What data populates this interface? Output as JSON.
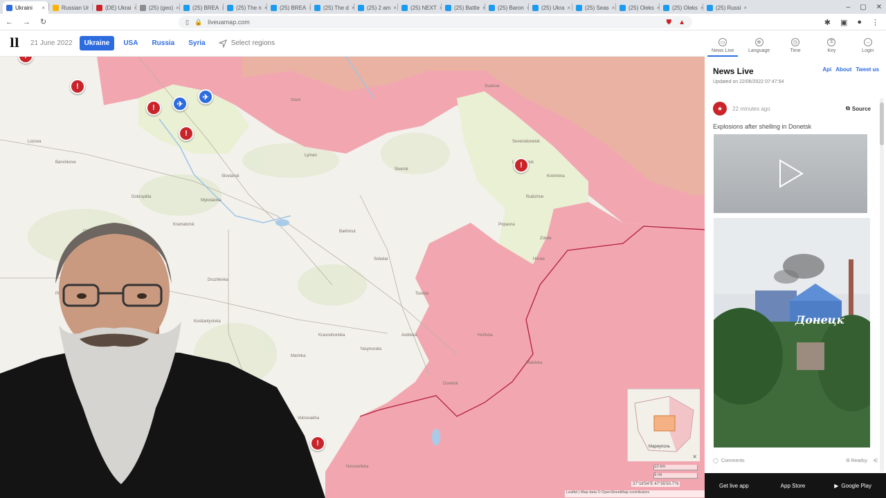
{
  "browser": {
    "tabs": [
      {
        "label": "Ukraini",
        "color": "#2d6cdf"
      },
      {
        "label": "Russian Ur",
        "color": "#ffb300"
      },
      {
        "label": "(DE) Ukrai",
        "color": "#c8242a"
      },
      {
        "label": "(25) (geo)",
        "color": "#8d8d8d"
      },
      {
        "label": "(25) BREA",
        "color": "#1d9bf0"
      },
      {
        "label": "(25) The n",
        "color": "#1d9bf0"
      },
      {
        "label": "(25) BREA",
        "color": "#1d9bf0"
      },
      {
        "label": "(25) The d",
        "color": "#1d9bf0"
      },
      {
        "label": "(25) 2 am",
        "color": "#1d9bf0"
      },
      {
        "label": "(25) NEXT",
        "color": "#1d9bf0"
      },
      {
        "label": "(25) Battle",
        "color": "#1d9bf0"
      },
      {
        "label": "(25) Baron",
        "color": "#1d9bf0"
      },
      {
        "label": "(25) Ukra",
        "color": "#1d9bf0"
      },
      {
        "label": "(25) Seas",
        "color": "#1d9bf0"
      },
      {
        "label": "(25) Oleks",
        "color": "#1d9bf0"
      },
      {
        "label": "(25) Oleks",
        "color": "#1d9bf0"
      },
      {
        "label": "(25) Russi",
        "color": "#1d9bf0"
      }
    ],
    "url": "liveuamap.com"
  },
  "site": {
    "logo": "ll",
    "date": "21 June 2022",
    "regions": [
      {
        "label": "Ukraine",
        "active": true
      },
      {
        "label": "USA",
        "active": false
      },
      {
        "label": "Russia",
        "active": false
      },
      {
        "label": "Syria",
        "active": false
      }
    ],
    "select_regions": "Select regions"
  },
  "panel_nav": [
    {
      "label": "News Live",
      "icon": "doc-icon",
      "glyph": "▭",
      "active": true
    },
    {
      "label": "Language",
      "icon": "globe-icon",
      "glyph": "⊕",
      "active": false
    },
    {
      "label": "Time",
      "icon": "clock-icon",
      "glyph": "◷",
      "active": false
    },
    {
      "label": "Key",
      "icon": "key-icon",
      "glyph": "⚿",
      "active": false
    },
    {
      "label": "Login",
      "icon": "login-icon",
      "glyph": "→",
      "active": false
    }
  ],
  "news": {
    "title": "News Live",
    "links": [
      "Api",
      "About",
      "Tweet us"
    ],
    "updated": "Updated on 22/06/2022 07:47:54",
    "item": {
      "time": "22 minutes ago",
      "source_label": "Source",
      "text": "Explosions after shelling in Donetsk",
      "image_sign": "Донецк"
    },
    "footer_left": "Comments",
    "footer_right": "Ilі Readsy"
  },
  "apps": [
    "Get live app",
    "App Store",
    "Google Play"
  ],
  "map": {
    "place_names": [
      "Severodonetsk",
      "Lysychansk",
      "Sloviansk",
      "Kramatorsk",
      "Druzhkivka",
      "Kostiantynivka",
      "Bakhmut",
      "Soledar",
      "Siversk",
      "Lyman",
      "Izium",
      "Popasna",
      "Horlivka",
      "Donetsk",
      "Avdiivka",
      "Pokrovsk",
      "Myrnohrad",
      "Kurakhove",
      "Vuhledar",
      "Volnovakha",
      "Dobropillia",
      "Barvinkove",
      "Lozova",
      "Svatove",
      "Kreminna",
      "Rubizhne",
      "Mykolaivka",
      "Zolote",
      "Hirske",
      "Toretsk",
      "Yasynuvata",
      "Makiivka",
      "Marinka",
      "Krasnohorivka",
      "Selydove",
      "Oleksandrivka",
      "Novoselivka"
    ],
    "coords_text": "37°18'54\"E 47°55'50.7\"N",
    "attribution": "Leaflet | Map data © OpenStreetMap contributors",
    "minimap_label": "Мариуполь",
    "scale_labels": [
      "10 km",
      "5 mi"
    ]
  },
  "colors": {
    "occupied": "#f2a7b0",
    "occupied_dark": "#e8c2a6",
    "liberated": "#e7ecd9",
    "accent": "#2d6cdf",
    "pin_red": "#c8242a"
  }
}
